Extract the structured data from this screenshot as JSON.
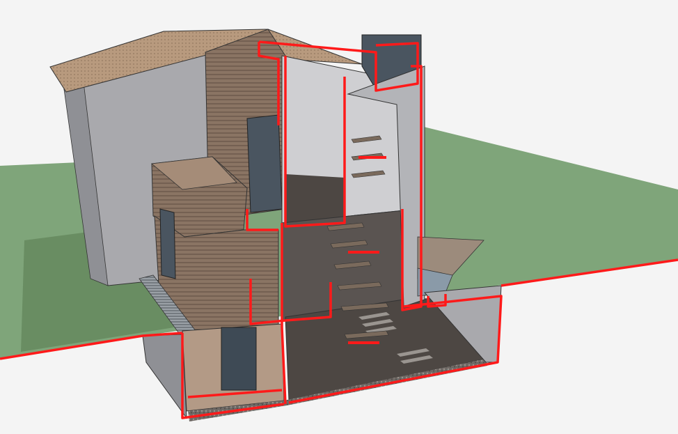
{
  "scene": {
    "description_label": "",
    "colors": {
      "sky": "#f4f4f4",
      "grass": "#7fa57a",
      "grass_dark": "#6f9569",
      "cut_line": "#ff1a1a",
      "wall_grey": "#a9a9ad",
      "wall_grey_dark": "#8f9095",
      "wood": "#8a7463",
      "wood_dark": "#6e5a4b",
      "roof": "#b89a7e",
      "interior": "#4d4743",
      "interior_light": "#cfcfd2",
      "glass": "#4a5560",
      "gravel": "#7c7672"
    }
  }
}
